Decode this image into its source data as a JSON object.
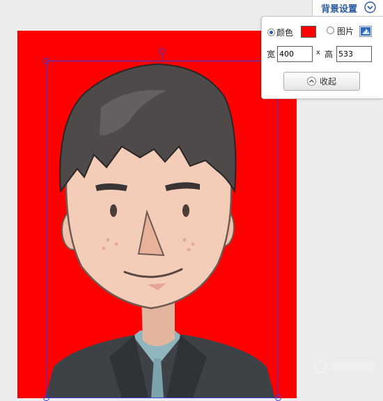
{
  "panel": {
    "title": "背景设置",
    "toggle_icon": "chevron-down-circle-icon",
    "color_option_label": "颜色",
    "image_option_label": "图片",
    "selected_option": "color",
    "background_color": "#ff0000",
    "width_label": "宽",
    "width_value": "400",
    "times_label": "x",
    "height_label": "高",
    "height_value": "533",
    "collapse_label": "收起",
    "collapse_icon": "chevron-up-circle-icon",
    "image_picker_icon": "picture-icon"
  },
  "canvas": {
    "background_color": "#ff0000",
    "selection_color": "#3b3bd8"
  }
}
